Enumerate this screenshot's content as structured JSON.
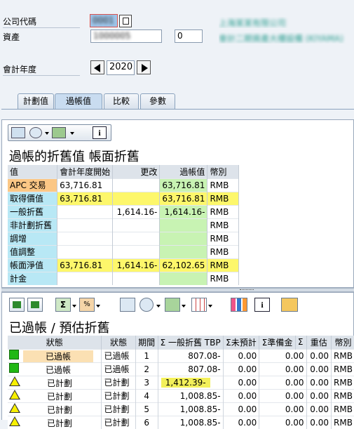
{
  "header": {
    "company_code_label": "公司代碼",
    "company_code_value": "0001",
    "company_name": "上海某某有限公司",
    "asset_label": "資產",
    "asset_value": "1000005",
    "asset_sub_value": "0",
    "asset_description": "會計二期資產大樓設備 (KIYAMA)",
    "fiscal_year_label": "會計年度",
    "fiscal_year_value": "2020"
  },
  "tabs": [
    {
      "label": "計劃值"
    },
    {
      "label": "過帳值"
    },
    {
      "label": "比較"
    },
    {
      "label": "參數"
    }
  ],
  "posted_values": {
    "title": "過帳的折舊值 帳面折舊",
    "columns": [
      "值",
      "會計年度開始",
      "更改",
      "過帳值",
      "幣別"
    ],
    "rows": [
      {
        "label": "APC 交易",
        "start": "63,716.81",
        "change": "",
        "posted": "63,716.81",
        "currency": "RMB"
      },
      {
        "label": "取得價值",
        "start": "63,716.81",
        "change": "",
        "posted": "63,716.81",
        "currency": "RMB"
      },
      {
        "label": "一般折舊",
        "start": "",
        "change": "1,614.16-",
        "posted": "1,614.16-",
        "currency": "RMB"
      },
      {
        "label": "非計劃折舊",
        "start": "",
        "change": "",
        "posted": "",
        "currency": "RMB"
      },
      {
        "label": "調增",
        "start": "",
        "change": "",
        "posted": "",
        "currency": "RMB"
      },
      {
        "label": "值調整",
        "start": "",
        "change": "",
        "posted": "",
        "currency": "RMB"
      },
      {
        "label": "帳面淨值",
        "start": "63,716.81",
        "change": "1,614.16-",
        "posted": "62,102.65",
        "currency": "RMB"
      },
      {
        "label": "計金",
        "start": "",
        "change": "",
        "posted": "",
        "currency": "RMB"
      }
    ]
  },
  "depreciation": {
    "title": "已過帳 / 預估折舊",
    "columns": [
      "狀態",
      "狀態",
      "期間",
      "Σ 一般折舊 TBP",
      "Σ未預計",
      "Σ準備金",
      "Σ",
      "重估",
      "幣別"
    ],
    "rows": [
      {
        "icon": "green",
        "status1": "已過帳",
        "status2": "已過帳",
        "period": "1",
        "ordinary": "807.08-",
        "unplanned": "0.00",
        "reserve": "0.00",
        "revaluation": "0.00",
        "currency": "RMB"
      },
      {
        "icon": "green",
        "status1": "已過帳",
        "status2": "已過帳",
        "period": "2",
        "ordinary": "807.08-",
        "unplanned": "0.00",
        "reserve": "0.00",
        "revaluation": "0.00",
        "currency": "RMB"
      },
      {
        "icon": "yellow",
        "status1": "已計劃",
        "status2": "已計劃",
        "period": "3",
        "ordinary": "1,412.39-",
        "unplanned": "0.00",
        "reserve": "0.00",
        "revaluation": "0.00",
        "currency": "RMB"
      },
      {
        "icon": "yellow",
        "status1": "已計劃",
        "status2": "已計劃",
        "period": "4",
        "ordinary": "1,008.85-",
        "unplanned": "0.00",
        "reserve": "0.00",
        "revaluation": "0.00",
        "currency": "RMB"
      },
      {
        "icon": "yellow",
        "status1": "已計劃",
        "status2": "已計劃",
        "period": "5",
        "ordinary": "1,008.85-",
        "unplanned": "0.00",
        "reserve": "0.00",
        "revaluation": "0.00",
        "currency": "RMB"
      },
      {
        "icon": "yellow",
        "status1": "已計劃",
        "status2": "已計劃",
        "period": "6",
        "ordinary": "1,008.85-",
        "unplanned": "0.00",
        "reserve": "0.00",
        "revaluation": "0.00",
        "currency": "RMB"
      }
    ]
  }
}
